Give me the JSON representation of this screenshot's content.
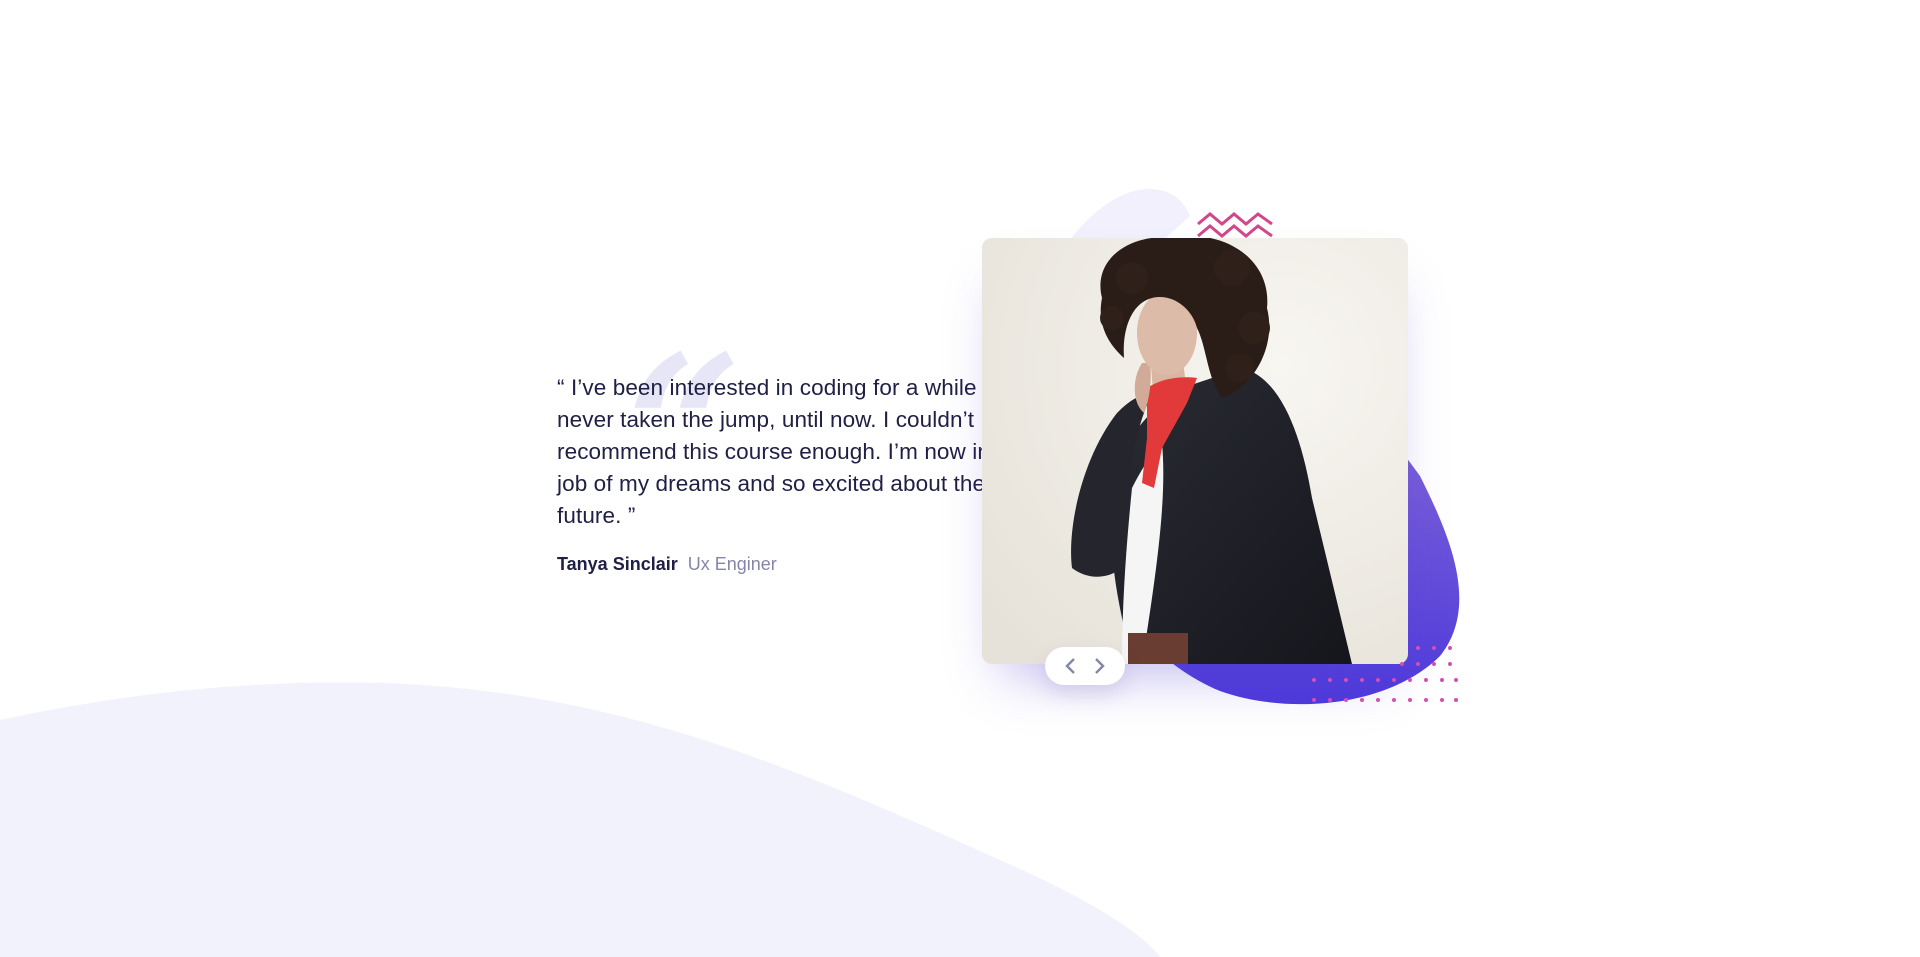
{
  "testimonial": {
    "quote": "“ I’ve been interested in coding for a while but never taken the jump, until now. I couldn’t recommend this course enough. I’m now in the job of my dreams and so excited about the future. ”",
    "author_name": "Tanya Sinclair",
    "author_role": "Ux Enginer",
    "quote_mark": "“"
  },
  "photo": {
    "alt": "Portrait of Tanya Sinclair"
  },
  "slider": {
    "prev_icon": "chevron-left-icon",
    "next_icon": "chevron-right-icon"
  },
  "colors": {
    "text_dark": "#202046",
    "text_muted": "#8585ac",
    "accent_purple": "#5a46d8",
    "accent_pink": "#d1478b",
    "background_curve": "#f2f2fc"
  }
}
